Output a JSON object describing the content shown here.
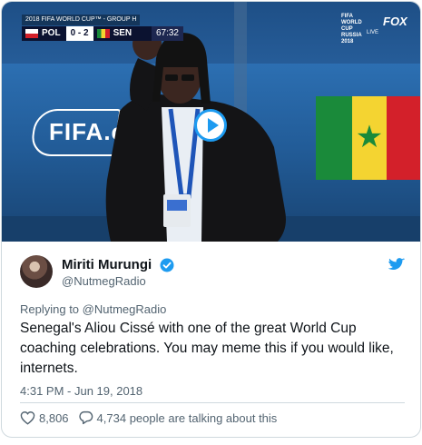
{
  "video": {
    "score_bug": {
      "competition": "2018 FIFA WORLD CUP™ - GROUP H",
      "home_team": "POL",
      "score": "0 - 2",
      "away_team": "SEN",
      "clock": "67:32"
    },
    "broadcast_brand_line1": "FIFA WORLD CUP",
    "broadcast_brand_line2": "RUSSIA 2018",
    "network": "FOX",
    "live_label": "LIVE",
    "board_text": "FIFA.c",
    "colors": {
      "pitch_blue": "#225c98",
      "accent": "#1d9bf0"
    }
  },
  "tweet": {
    "author_name": "Miriti Murungi",
    "author_handle": "@NutmegRadio",
    "verified_icon": "verified-badge-icon",
    "platform_icon": "twitter-bird-icon",
    "reply_prefix": "Replying to",
    "reply_to": "@NutmegRadio",
    "text": "Senegal's Aliou Cissé with one of the great World Cup coaching celebrations. You may meme this if you would like, internets.",
    "timestamp": "4:31 PM - Jun 19, 2018",
    "likes": "8,806",
    "talking": "4,734 people are talking about this",
    "colors": {
      "brand": "#1d9bf0",
      "text": "#0f1419",
      "muted": "#536471"
    }
  }
}
